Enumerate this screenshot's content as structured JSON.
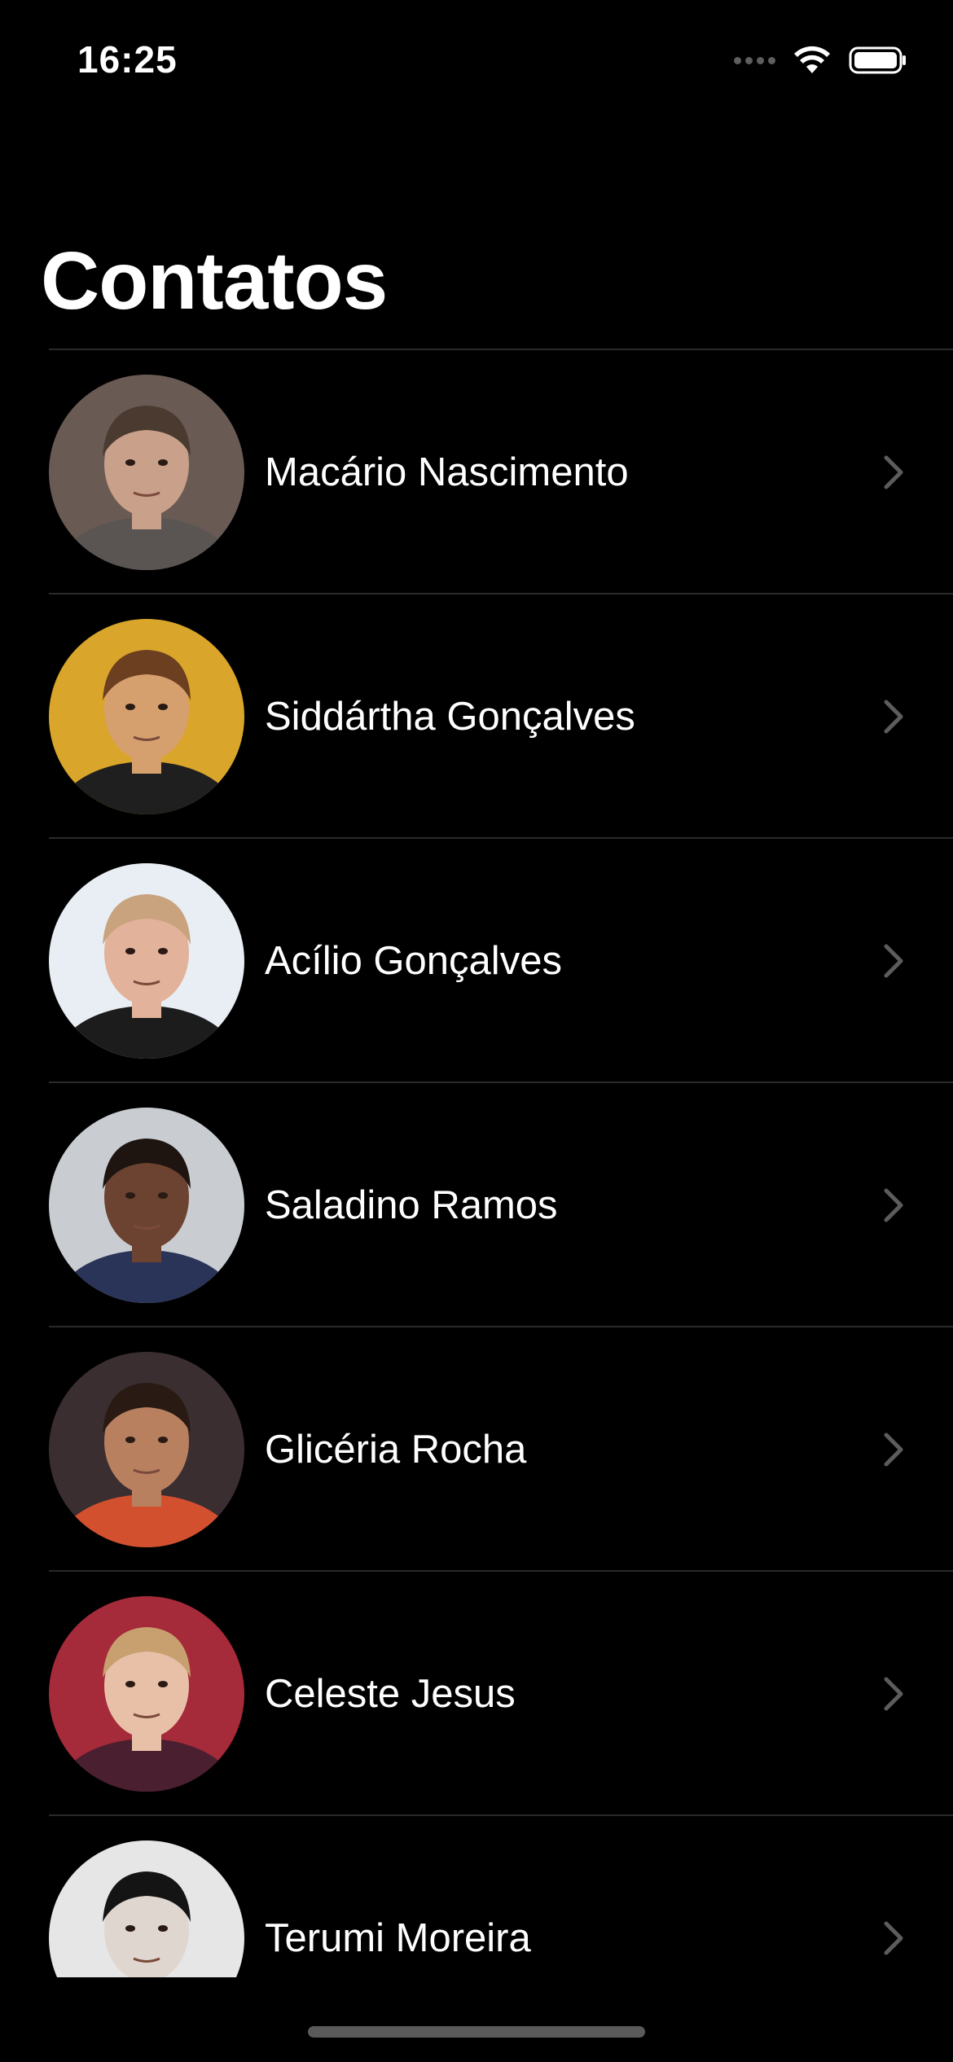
{
  "status_bar": {
    "time": "16:25",
    "icons": [
      "signal-dots-icon",
      "wifi-icon",
      "battery-icon"
    ]
  },
  "header": {
    "title": "Contatos"
  },
  "contacts": [
    {
      "name": "Macário Nascimento",
      "avatar": "photo-man-gray-shirt",
      "bg": "#6a5a54",
      "skin": "#c9a08a",
      "hair": "#4a3a30",
      "shirt": "#5a5553"
    },
    {
      "name": "Siddártha Gonçalves",
      "avatar": "photo-man-yellow-bg",
      "bg": "#d9a52a",
      "skin": "#d6a06e",
      "hair": "#6b3f1f",
      "shirt": "#1f1f1f"
    },
    {
      "name": "Acílio Gonçalves",
      "avatar": "photo-man-smiling-white-bg",
      "bg": "#e8eef3",
      "skin": "#e2b29a",
      "hair": "#c9a27e",
      "shirt": "#1c1c1c"
    },
    {
      "name": "Saladino Ramos",
      "avatar": "photo-man-suit-tie",
      "bg": "#c9cdd2",
      "skin": "#6b4330",
      "hair": "#1e1410",
      "shirt": "#2a3358"
    },
    {
      "name": "Glicéria Rocha",
      "avatar": "photo-woman-orange-top",
      "bg": "#3a2e30",
      "skin": "#b98060",
      "hair": "#2a1a14",
      "shirt": "#d2502e"
    },
    {
      "name": "Celeste Jesus",
      "avatar": "photo-woman-curly-hair",
      "bg": "#a52a3a",
      "skin": "#e8c0a8",
      "hair": "#c8a070",
      "shirt": "#4a2030"
    },
    {
      "name": "Terumi Moreira",
      "avatar": "photo-woman-beanie-glasses",
      "bg": "#e6e6e6",
      "skin": "#e0d6d0",
      "hair": "#141414",
      "shirt": "#2a2a2a"
    }
  ],
  "colors": {
    "background": "#000000",
    "text": "#ffffff",
    "divider": "#2a2a2a",
    "chevron": "#5c5c5c"
  }
}
